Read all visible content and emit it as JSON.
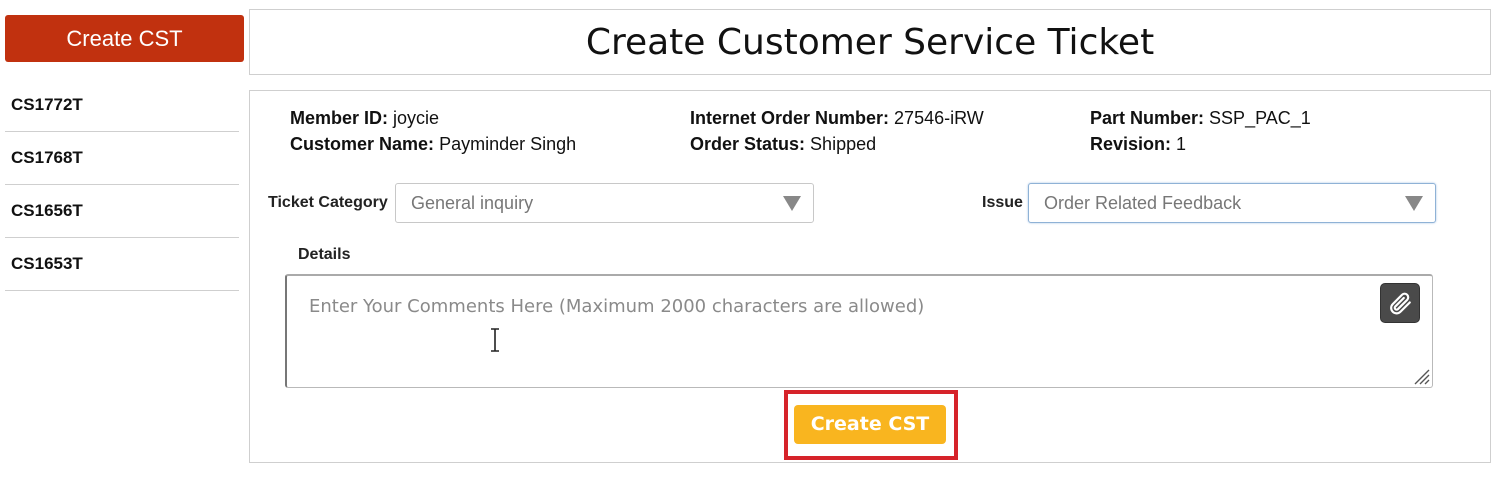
{
  "sidebar": {
    "create_button_label": "Create CST",
    "tickets": [
      {
        "id": "CS1772T"
      },
      {
        "id": "CS1768T"
      },
      {
        "id": "CS1656T"
      },
      {
        "id": "CS1653T"
      }
    ]
  },
  "header": {
    "title": "Create Customer Service Ticket"
  },
  "info": {
    "member_id_label": "Member ID:",
    "member_id": "joycie",
    "customer_name_label": "Customer Name:",
    "customer_name": "Payminder Singh",
    "internet_order_label": "Internet Order Number:",
    "internet_order": "27546-iRW",
    "order_status_label": "Order Status:",
    "order_status": "Shipped",
    "part_number_label": "Part Number:",
    "part_number": "SSP_PAC_1",
    "revision_label": "Revision:",
    "revision": "1"
  },
  "form": {
    "ticket_category_label": "Ticket Category",
    "ticket_category_value": "General inquiry",
    "issue_label": "Issue",
    "issue_value": "Order Related Feedback",
    "details_label": "Details",
    "details_placeholder": "Enter Your Comments Here (Maximum 2000 characters are allowed)",
    "submit_label": "Create CST"
  },
  "colors": {
    "sidebar_button": "#c1310f",
    "submit_button": "#f9b51f",
    "highlight": "#d6232a"
  },
  "icons": {
    "attach": "paperclip-icon",
    "arrow": "chevron-down-icon",
    "resize": "resize-handle-icon",
    "cursor": "text-cursor-icon"
  }
}
